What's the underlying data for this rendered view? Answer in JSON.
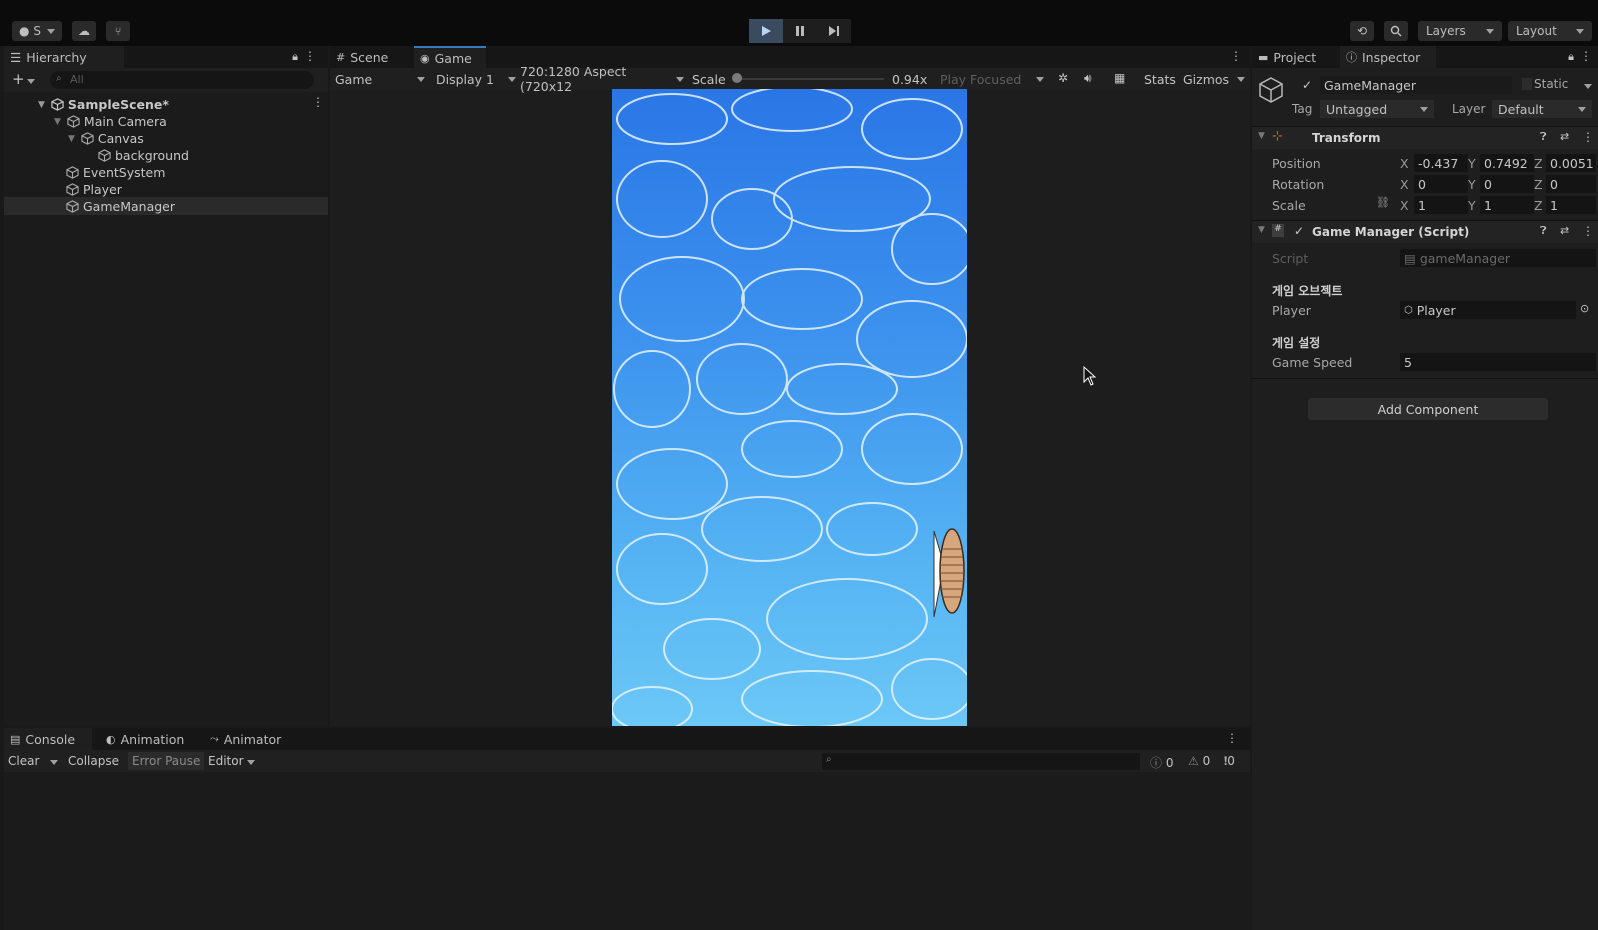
{
  "toolbar": {
    "account_label": "S",
    "layers_label": "Layers",
    "layout_label": "Layout"
  },
  "hierarchy": {
    "tab_label": "Hierarchy",
    "search_placeholder": "All",
    "scene_name": "SampleScene*",
    "items": [
      {
        "label": "Main Camera"
      },
      {
        "label": "Canvas"
      },
      {
        "label": "background"
      },
      {
        "label": "EventSystem"
      },
      {
        "label": "Player"
      },
      {
        "label": "GameManager"
      }
    ]
  },
  "view": {
    "tabs": [
      {
        "label": "Scene"
      },
      {
        "label": "Game"
      }
    ],
    "game_dropdown": "Game",
    "display_dropdown": "Display 1",
    "aspect_dropdown": "720:1280 Aspect (720x12",
    "scale_label": "Scale",
    "scale_value": 0.94,
    "scale_value_label": "0.94x",
    "play_focused": "Play Focused",
    "stats": "Stats",
    "gizmos": "Gizmos"
  },
  "inspector": {
    "tabs": [
      {
        "label": "Project"
      },
      {
        "label": "Inspector"
      }
    ],
    "object_name": "GameManager",
    "static_label": "Static",
    "tag_label": "Tag",
    "tag_value": "Untagged",
    "layer_label": "Layer",
    "layer_value": "Default",
    "transform": {
      "title": "Transform",
      "position_label": "Position",
      "rotation_label": "Rotation",
      "scale_label": "Scale",
      "position": {
        "x": "-0.437",
        "y": "0.7492",
        "z": "0.0051"
      },
      "rotation": {
        "x": "0",
        "y": "0",
        "z": "0"
      },
      "scale": {
        "x": "1",
        "y": "1",
        "z": "1"
      }
    },
    "script_component": {
      "title": "Game Manager (Script)",
      "script_label": "Script",
      "script_value": "gameManager",
      "section1": "게임 오브젝트",
      "player_label": "Player",
      "player_value": "Player",
      "section2": "게임 설정",
      "speed_label": "Game Speed",
      "speed_value": "5"
    },
    "add_component": "Add Component"
  },
  "console": {
    "tabs": [
      {
        "label": "Console"
      },
      {
        "label": "Animation"
      },
      {
        "label": "Animator"
      }
    ],
    "clear": "Clear",
    "collapse": "Collapse",
    "error_pause": "Error Pause",
    "editor": "Editor",
    "info_count": "0",
    "warn_count": "0",
    "error_count": "0"
  },
  "axis_labels": {
    "x": "X",
    "y": "Y",
    "z": "Z"
  },
  "colors": {
    "accent_blue": "#3a79bb",
    "panel_bg": "#1b1b1b",
    "water_top": "#2a76e6",
    "water_bottom": "#6cc8f6"
  }
}
